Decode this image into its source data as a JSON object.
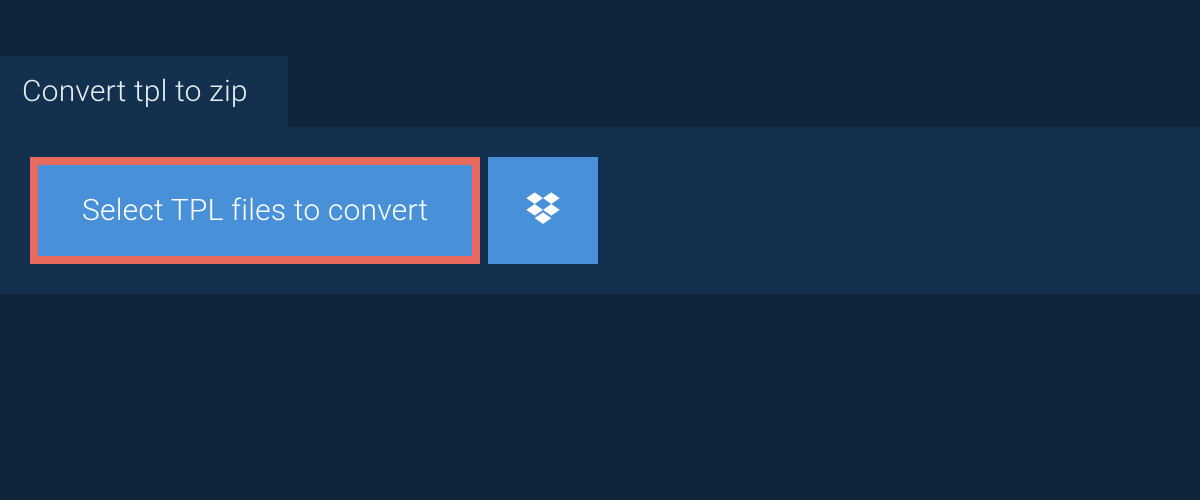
{
  "tab": {
    "label": "Convert tpl to zip"
  },
  "upload": {
    "select_label": "Select TPL files to convert",
    "dropbox_icon": "dropbox-icon"
  },
  "colors": {
    "background": "#0f2438",
    "panel": "#13314f",
    "button": "#4890d8",
    "highlight_border": "#e86a5e",
    "text_light": "#ffffff",
    "text_muted": "#e8eef4"
  }
}
